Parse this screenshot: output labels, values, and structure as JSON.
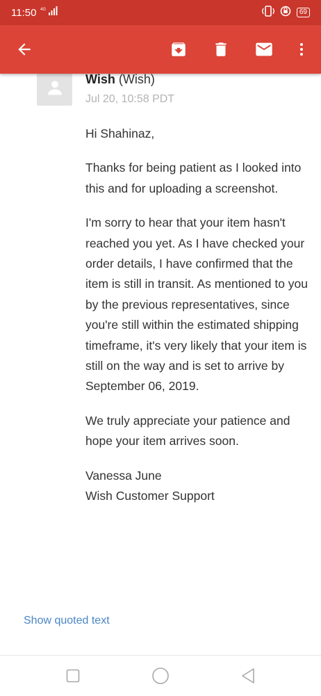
{
  "status_bar": {
    "time": "11:50",
    "network": "4G",
    "battery": "69"
  },
  "toolbar": {
    "icons": [
      "back-arrow-icon",
      "archive-icon",
      "delete-icon",
      "mark-unread-icon",
      "more-vert-icon"
    ],
    "color": "#db4437"
  },
  "message": {
    "sender_name": "Wish",
    "sender_alias": "(Wish)",
    "date": "Jul 20, 10:58 PDT",
    "greeting": "Hi Shahinaz,",
    "paragraph1": "Thanks for being patient as I looked into this and for uploading a screenshot.",
    "paragraph2": "I'm sorry to hear that your item hasn't reached you yet. As I have checked your order details, I have confirmed that the item is still in transit. As mentioned to you by the previous representatives, since you're still within the estimated shipping timeframe, it's very likely that your item is still on the way and is set to arrive by September 06, 2019.",
    "paragraph3": "We truly appreciate your patience and hope your item arrives soon.",
    "signature_name": "Vanessa June",
    "signature_team": "Wish Customer Support"
  },
  "show_quoted_text": "Show quoted text",
  "nav_bar": {
    "icons": [
      "recent-apps-icon",
      "home-icon",
      "back-icon"
    ]
  }
}
